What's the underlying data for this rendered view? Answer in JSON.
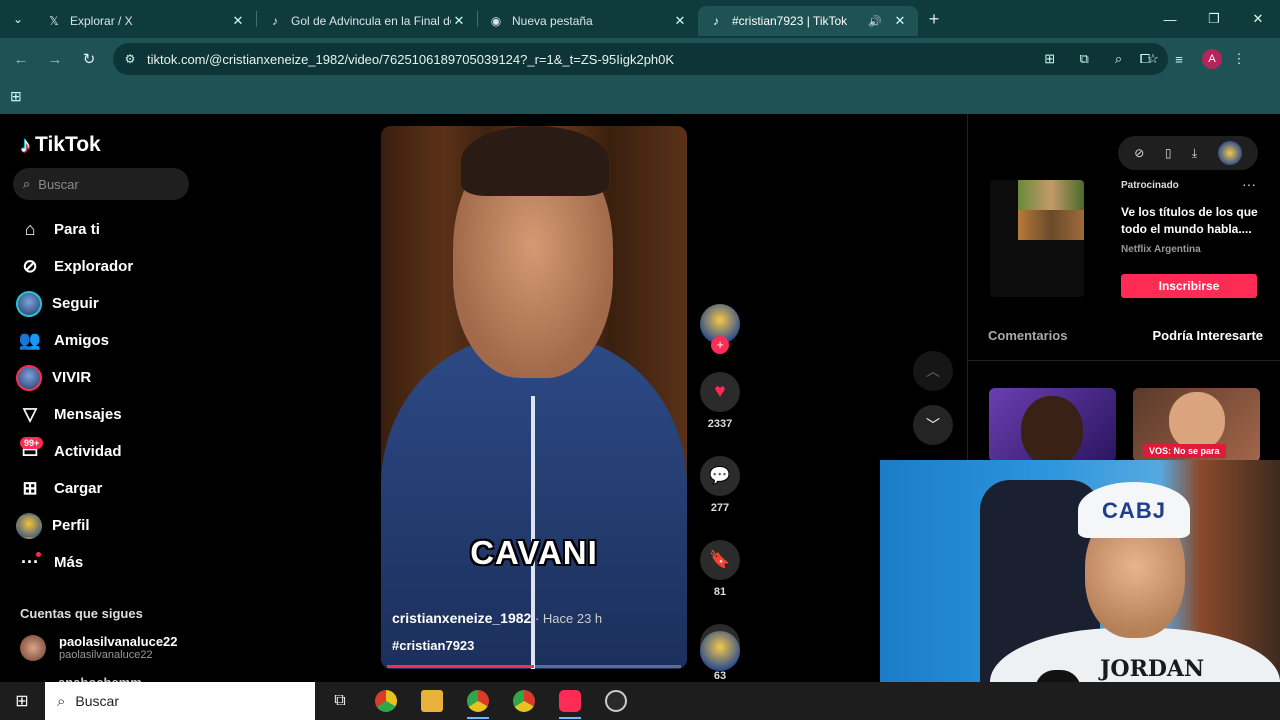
{
  "browser": {
    "tabs": [
      {
        "title": "Explorar / X",
        "icon": "x-logo-icon",
        "active": false
      },
      {
        "title": "Gol de Advincula en la Final de",
        "icon": "tiktok-icon",
        "active": false
      },
      {
        "title": "Nueva pestaña",
        "icon": "chrome-icon",
        "active": false
      },
      {
        "title": "#cristian7923 | TikTok",
        "icon": "tiktok-icon",
        "active": true
      }
    ],
    "url": "tiktok.com/@cristianxeneize_1982/video/7625106189705039124?_r=1&_t=ZS-95Iigk2ph0K",
    "profile_initial": "A"
  },
  "sidebar": {
    "logo": "TikTok",
    "search_placeholder": "Buscar",
    "items": [
      {
        "label": "Para ti",
        "icon": "home-icon"
      },
      {
        "label": "Explorador",
        "icon": "compass-icon"
      },
      {
        "label": "Seguir",
        "icon": "following-avatar-icon"
      },
      {
        "label": "Amigos",
        "icon": "friends-icon"
      },
      {
        "label": "VIVIR",
        "icon": "live-avatar-icon"
      },
      {
        "label": "Mensajes",
        "icon": "send-icon"
      },
      {
        "label": "Actividad",
        "icon": "inbox-icon",
        "badge": "99+"
      },
      {
        "label": "Cargar",
        "icon": "upload-icon"
      },
      {
        "label": "Perfil",
        "icon": "profile-avatar-icon"
      },
      {
        "label": "Más",
        "icon": "more-icon"
      }
    ],
    "following_title": "Cuentas que sigues",
    "following": [
      {
        "name": "paolasilvanaluce22",
        "handle": "paolasilvanaluce22"
      },
      {
        "name": "anabochemm"
      }
    ]
  },
  "video": {
    "caption": "CAVANI",
    "author": "cristianxeneize_1982",
    "time": " · Hace 23 h",
    "hashtag": "#cristian7923",
    "progress": 0.5,
    "likes": "2337",
    "comments": "277",
    "saves": "81",
    "shares": "63"
  },
  "right_panel": {
    "ad": {
      "sponsored": "Patrocinado",
      "title": "Ve los títulos de los que todo el mundo habla....",
      "brand": "Netflix Argentina",
      "cta": "Inscribirse"
    },
    "tabs": [
      "Comentarios",
      "Podría Interesarte"
    ],
    "active_tab": 1,
    "recommended_caption": "VOS: No se para"
  },
  "webcam": {
    "cap_text": "CABJ",
    "shirt_text": "JORDAN"
  },
  "taskbar": {
    "search_placeholder": "Buscar"
  }
}
